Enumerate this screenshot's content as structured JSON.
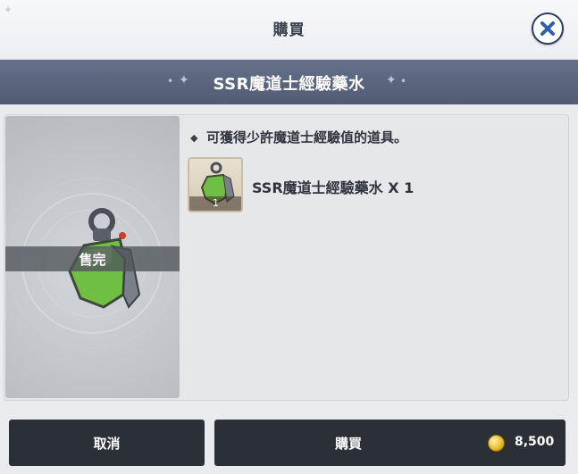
{
  "header": {
    "title": "購買",
    "close_icon": "close-x-icon"
  },
  "item": {
    "name": "SSR魔道士經驗藥水",
    "status_overlay": "售完",
    "description": "可獲得少許魔道士經驗值的道具。",
    "reward_label": "SSR魔道士經驗藥水 X 1",
    "reward_quantity": "1",
    "icon": "green-potion-flask-icon"
  },
  "buttons": {
    "cancel_label": "取消",
    "buy_label": "購買",
    "price": "8,500",
    "currency_icon": "gold-coin-icon"
  },
  "colors": {
    "name_bar": "#5b6580",
    "button_bg": "#2b2f36",
    "close_border": "#2f3d5e",
    "potion_green": "#7cc54a"
  }
}
